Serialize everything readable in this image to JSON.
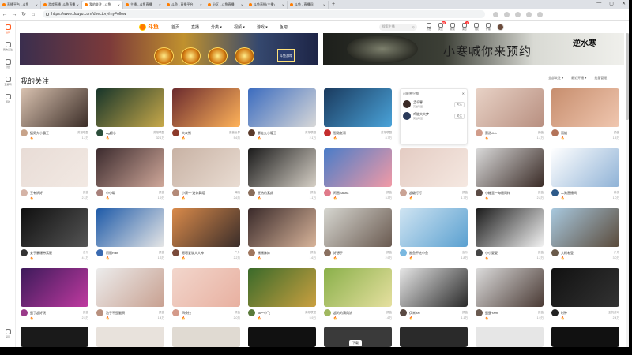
{
  "browser": {
    "tabs": [
      {
        "label": "直播平台 - 斗鱼"
      },
      {
        "label": "游戏直播_斗鱼直播"
      },
      {
        "label": "我的关注 - 斗鱼"
      },
      {
        "label": "主播 - 斗鱼直播"
      },
      {
        "label": "斗鱼 - 直播平台"
      },
      {
        "label": "分区 - 斗鱼直播"
      },
      {
        "label": "斗鱼直播(主播)"
      },
      {
        "label": "斗鱼 - 直播间"
      }
    ],
    "new_tab": "+",
    "url": "https://www.douyu.com/directory/myFollow",
    "window_controls": [
      "—",
      "▢",
      "✕"
    ]
  },
  "sidebar": {
    "items": [
      {
        "label": "推荐"
      },
      {
        "label": "我的关注"
      },
      {
        "label": "分类"
      },
      {
        "label": "直播间"
      },
      {
        "label": "活动"
      }
    ],
    "bottom": "设置"
  },
  "header": {
    "logo": "斗鱼",
    "menu": [
      "首页",
      "直播",
      "分类 ▾",
      "视频 ▾",
      "游戏 ▾",
      "鱼吧"
    ],
    "search_placeholder": "搜索主播",
    "icons": [
      {
        "name": "history-icon",
        "label": "历史"
      },
      {
        "name": "follow-icon",
        "label": "关注",
        "badge": "99"
      },
      {
        "name": "video-icon",
        "label": "视频"
      },
      {
        "name": "message-icon",
        "label": "消息",
        "badge": "1"
      },
      {
        "name": "download-icon",
        "label": "下载"
      },
      {
        "name": "live-icon",
        "label": "开播"
      }
    ]
  },
  "banner": {
    "left_tag": "斗鱼游戏",
    "right_text": "小寒喊你来预约",
    "right_mark": "逆水寒"
  },
  "section": {
    "title": "我的关注",
    "options": [
      "全部关注 ▾",
      "最近开播 ▾",
      "批量管理"
    ]
  },
  "cards": [
    {
      "name": "猛男九小霸王",
      "cat": "英雄联盟",
      "hot": "1.2万",
      "colors": [
        "#d9c2b0",
        "#3a2c26"
      ],
      "av": "#c7a38a"
    },
    {
      "name": "Ag超小",
      "cat": "英雄联盟",
      "hot": "32.1万",
      "colors": [
        "#17352a",
        "#c8a94a"
      ],
      "av": "#2b4d3a"
    },
    {
      "name": "大灰熊",
      "cat": "魔兽世界",
      "hot": "5.6万",
      "colors": [
        "#6b2b2e",
        "#ffb35a"
      ],
      "av": "#8c3a2a"
    },
    {
      "name": "暴走九小瞳王",
      "cat": "英雄联盟",
      "hot": "2.1万",
      "colors": [
        "#3c6cbf",
        "#d8d8d8"
      ],
      "av": "#5b3a2a"
    },
    {
      "name": "智勋老哥",
      "cat": "英雄联盟",
      "hot": "8.7万",
      "colors": [
        "#1a3a5e",
        "#4aa3d9"
      ],
      "av": "#c42d2d"
    },
    {
      "name": "POPUP",
      "cat": "",
      "hot": "",
      "colors": [
        "#ffffff",
        "#ffffff"
      ],
      "av": "#fff"
    },
    {
      "name": "票选rlbb",
      "cat": "颜值",
      "hot": "1.4万",
      "colors": [
        "#e8d2c6",
        "#b88f80"
      ],
      "av": "#d19c8a"
    },
    {
      "name": "丽姐~",
      "cat": "颜值",
      "hot": "1.5万",
      "colors": [
        "#c78e6e",
        "#f0c7b0"
      ],
      "av": "#b37359"
    },
    {
      "name": "王有妍好",
      "cat": "颜值",
      "hot": "2.3万",
      "colors": [
        "#e8dcd6",
        "#f2e9e3"
      ],
      "av": "#d4b3a6"
    },
    {
      "name": "小小璐",
      "cat": "颜值",
      "hot": "1.9万",
      "colors": [
        "#3c2b2e",
        "#d0a89a"
      ],
      "av": "#a7807a"
    },
    {
      "name": "小赛一·迷你舞蹈",
      "cat": "舞蹈",
      "hot": "2.6万",
      "colors": [
        "#c8b2a4",
        "#e9dcd2"
      ],
      "av": "#b38a78"
    },
    {
      "name": "狂热的素颜",
      "cat": "颜值",
      "hot": "1.1万",
      "colors": [
        "#1b1b1b",
        "#d6d0c6"
      ],
      "av": "#8a6d5a"
    },
    {
      "name": "阿雪Sasha",
      "cat": "颜值",
      "hot": "3.3万",
      "colors": [
        "#4a7cc8",
        "#f29aa6"
      ],
      "av": "#e07a8a"
    },
    {
      "name": "超级打打",
      "cat": "颜值",
      "hot": "1.7万",
      "colors": [
        "#e4ccc3",
        "#f5e8e1"
      ],
      "av": "#caa395"
    },
    {
      "name": "小糖里一每最同样",
      "cat": "颜值",
      "hot": "2.8万",
      "colors": [
        "#dadada",
        "#3a2b26"
      ],
      "av": "#5a4a44"
    },
    {
      "name": "二狗直播间",
      "cat": "科技",
      "hot": "1.0万",
      "colors": [
        "#ffffff",
        "#8fb2d6"
      ],
      "av": "#2d5a8a"
    },
    {
      "name": "安子暴爆带素肥",
      "cat": "音乐",
      "hot": "4.1万",
      "colors": [
        "#0f0f0f",
        "#555555"
      ],
      "av": "#333333"
    },
    {
      "name": "阿丽Rain",
      "cat": "颜值",
      "hot": "1.3万",
      "colors": [
        "#1e5aa8",
        "#e6e6e6"
      ],
      "av": "#3a6ab0"
    },
    {
      "name": "嗯嗯爱说大大神",
      "cat": "户外",
      "hot": "2.2万",
      "colors": [
        "#d98a4a",
        "#3a2d2a"
      ],
      "av": "#7a4a3a"
    },
    {
      "name": "嘿嘿妹妹",
      "cat": "颜值",
      "hot": "1.6万",
      "colors": [
        "#3a2a2a",
        "#d8b49a"
      ],
      "av": "#a0765e"
    },
    {
      "name": "好想子",
      "cat": "颜值",
      "hot": "2.9万",
      "colors": [
        "#d6d6d0",
        "#6a5a50"
      ],
      "av": "#8a7060"
    },
    {
      "name": "鲨鱼不吃小鱼",
      "cat": "鱼乐",
      "hot": "1.8万",
      "colors": [
        "#cfe4f2",
        "#5aa0d0"
      ],
      "av": "#7ab8e0"
    },
    {
      "name": "小小夏夏",
      "cat": "颜值",
      "hot": "1.2万",
      "colors": [
        "#1a1a1a",
        "#f2f2f2"
      ],
      "av": "#444444"
    },
    {
      "name": "大树老登",
      "cat": "户外",
      "hot": "3.0万",
      "colors": [
        "#a8c8de",
        "#5a4a3a"
      ],
      "av": "#6a5a4a"
    },
    {
      "name": "蛋了超好玩",
      "cat": "颜值",
      "hot": "2.5万",
      "colors": [
        "#3c1a5a",
        "#c03aa0"
      ],
      "av": "#9a3a8a"
    },
    {
      "name": "池子不歪腿啊",
      "cat": "颜值",
      "hot": "1.4万",
      "colors": [
        "#ececec",
        "#c8a090"
      ],
      "av": "#b8907e"
    },
    {
      "name": "四朵拉",
      "cat": "颜值",
      "hot": "2.0万",
      "colors": [
        "#f2d6cc",
        "#e8b0a0"
      ],
      "av": "#d49a8a"
    },
    {
      "name": "kk～小飞",
      "cat": "英雄联盟",
      "hot": "5.9万",
      "colors": [
        "#3a6a2a",
        "#caa040"
      ],
      "av": "#5a7a3a"
    },
    {
      "name": "超的的清风流",
      "cat": "颜值",
      "hot": "1.6万",
      "colors": [
        "#8ab04a",
        "#e6e0a0"
      ],
      "av": "#a0b860"
    },
    {
      "name": "伊米Yai",
      "cat": "颜值",
      "hot": "1.1万",
      "colors": [
        "#e6e6e6",
        "#2a2a2a"
      ],
      "av": "#5a4a44"
    },
    {
      "name": "蛋蛋Yami",
      "cat": "颜值",
      "hot": "1.9万",
      "colors": [
        "#dcdcdc",
        "#4a3a34"
      ],
      "av": "#6a5a50"
    },
    {
      "name": "时钟",
      "cat": "主机游戏",
      "hot": "2.4万",
      "colors": [
        "#111111",
        "#333333"
      ],
      "av": "#222222"
    }
  ],
  "popup": {
    "header_left": "可能感兴趣",
    "header_right": "✕",
    "rows": [
      {
        "name": "孟千寒",
        "desc": "英雄联盟",
        "btn": "关注",
        "av": "#3a2a26"
      },
      {
        "name": "鸡能大大梦",
        "desc": "英雄联盟",
        "btn": "关注",
        "av": "#2a3a5a"
      }
    ]
  },
  "bottom": {
    "label": "下载"
  }
}
